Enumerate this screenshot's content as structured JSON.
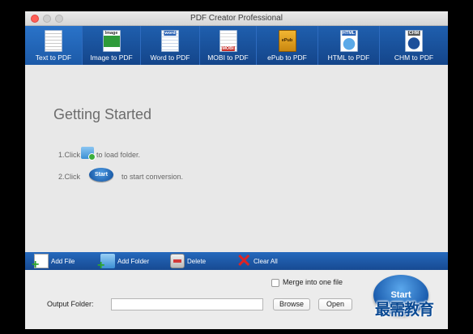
{
  "window": {
    "title": "PDF Creator Professional"
  },
  "ribbon": {
    "tabs": [
      {
        "label": "Text to PDF",
        "icon": "text-doc-icon",
        "active": true
      },
      {
        "label": "Image to PDF",
        "icon": "image-doc-icon",
        "badge": "Image"
      },
      {
        "label": "Word to PDF",
        "icon": "word-doc-icon",
        "badge": "word"
      },
      {
        "label": "MOBI to PDF",
        "icon": "mobi-doc-icon",
        "badge": "MOBI"
      },
      {
        "label": "ePub to PDF",
        "icon": "epub-doc-icon",
        "badge": "ePub"
      },
      {
        "label": "HTML to PDF",
        "icon": "html-doc-icon",
        "badge": "HTML"
      },
      {
        "label": "CHM to PDF",
        "icon": "chm-doc-icon",
        "badge": "CHM"
      }
    ]
  },
  "content": {
    "title": "Getting Started",
    "step1_prefix": "1.Click",
    "step1_suffix": "to load folder.",
    "step2_prefix": "2.Click",
    "step2_button": "Start",
    "step2_suffix": "to start conversion."
  },
  "actions": {
    "add_file": "Add File",
    "add_folder": "Add Folder",
    "delete": "Delete",
    "clear_all": "Clear All"
  },
  "bottom": {
    "merge_label": "Merge into one file",
    "merge_checked": false,
    "output_folder_label": "Output Folder:",
    "output_folder_value": "",
    "browse_label": "Browse",
    "open_label": "Open",
    "start_label": "Start"
  },
  "watermark": "最需教育",
  "colors": {
    "ribbon": "#1a529c",
    "accent": "#1d5fb0"
  }
}
